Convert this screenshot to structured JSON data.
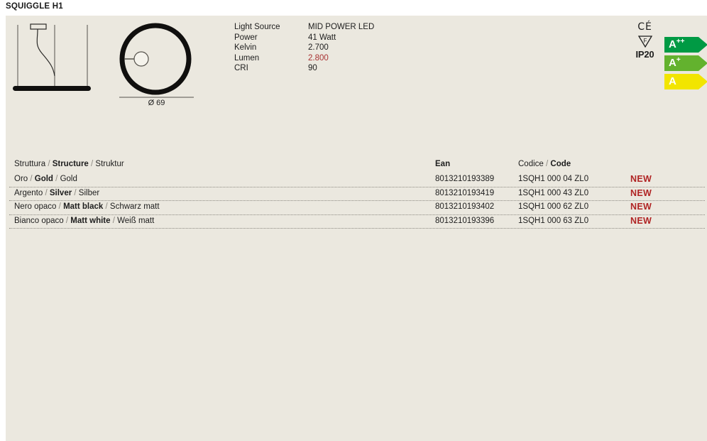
{
  "product": {
    "title": "SQUIGGLE H1"
  },
  "drawings": {
    "side_view_name": "side-elevation-drawing",
    "top_view_name": "top-plan-drawing",
    "diameter_label": "Ø 69"
  },
  "specifications": [
    {
      "label": "Light Source",
      "value": "MID POWER LED",
      "accent": false
    },
    {
      "label": "Power",
      "value": "41 Watt",
      "accent": false
    },
    {
      "label": "Kelvin",
      "value": "2.700",
      "accent": false
    },
    {
      "label": "Lumen",
      "value": "2.800",
      "accent": true
    },
    {
      "label": "CRI",
      "value": "90",
      "accent": false
    }
  ],
  "certifications": {
    "ce_mark": "CE",
    "mounting_mark": "F",
    "ip_rating": "IP20"
  },
  "energy_labels": [
    {
      "letter": "A",
      "sup": "++",
      "color": "#009a44"
    },
    {
      "letter": "A",
      "sup": "+",
      "color": "#63b22e"
    },
    {
      "letter": "A",
      "sup": "",
      "color": "#f2e500"
    }
  ],
  "table": {
    "headers": {
      "structure_it": "Struttura",
      "structure_en": "Structure",
      "structure_de": "Struktur",
      "ean": "Ean",
      "code_it": "Codice",
      "code_en": "Code"
    },
    "rows": [
      {
        "finish_it": "Oro",
        "finish_en": "Gold",
        "finish_de": "Gold",
        "ean": "8013210193389",
        "code": "1SQH1 000 04 ZL0",
        "badge": "NEW"
      },
      {
        "finish_it": "Argento",
        "finish_en": "Silver",
        "finish_de": "Silber",
        "ean": "8013210193419",
        "code": "1SQH1 000 43 ZL0",
        "badge": "NEW"
      },
      {
        "finish_it": "Nero opaco",
        "finish_en": "Matt black",
        "finish_de": "Schwarz matt",
        "ean": "8013210193402",
        "code": "1SQH1 000 62 ZL0",
        "badge": "NEW"
      },
      {
        "finish_it": "Bianco opaco",
        "finish_en": "Matt white",
        "finish_de": "Weiß matt",
        "ean": "8013210193396",
        "code": "1SQH1 000 63 ZL0",
        "badge": "NEW"
      }
    ]
  },
  "colors": {
    "sheet_background": "#ebe8df",
    "accent_red": "#a83232",
    "badge_red": "#b02424",
    "ink": "#1d1d1d"
  }
}
